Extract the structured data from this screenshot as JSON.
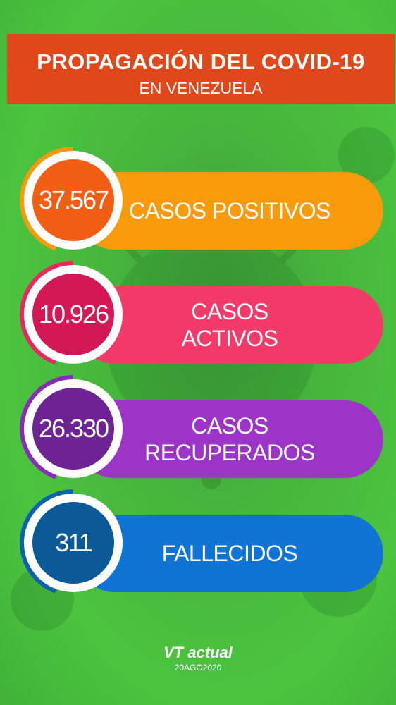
{
  "header": {
    "title": "PROPAGACIÓN DEL COVID-19",
    "subtitle": "EN VENEZUELA"
  },
  "stats": [
    {
      "value": "37.567",
      "label": "CASOS POSITIVOS",
      "color": "#f99a0a",
      "disc_color": "#f25f14"
    },
    {
      "value": "10.926",
      "label": "CASOS\nACTIVOS",
      "color": "#f33a6a",
      "disc_color": "#d31855"
    },
    {
      "value": "26.330",
      "label": "CASOS\nRECUPERADOS",
      "color": "#9c34c7",
      "disc_color": "#6d2394"
    },
    {
      "value": "311",
      "label": "FALLECIDOS",
      "color": "#0f74d4",
      "disc_color": "#0c5998"
    }
  ],
  "footer": {
    "brand": "VT actual",
    "date": "20AGO2020"
  },
  "icons": [
    "coronavirus-background-icon"
  ]
}
